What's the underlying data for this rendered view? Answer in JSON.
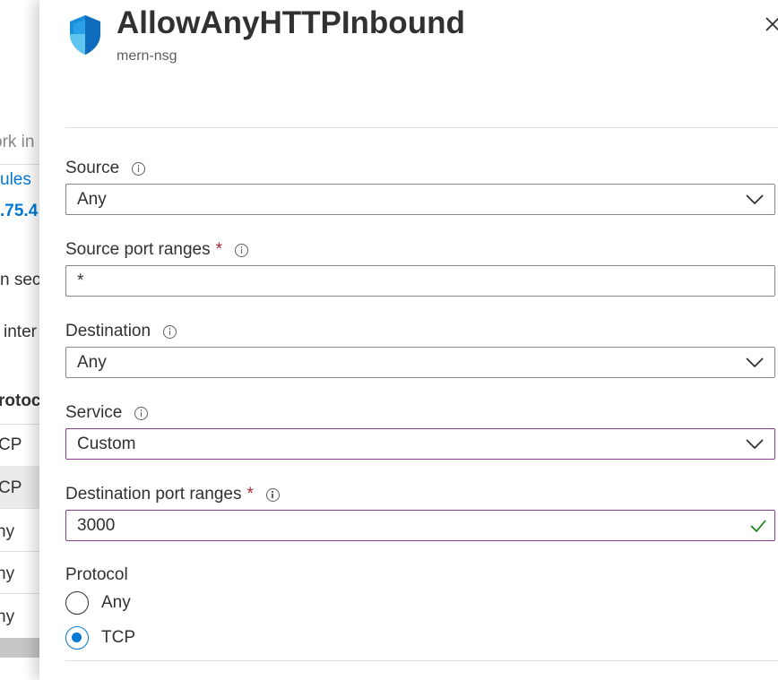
{
  "background": {
    "fragments": [
      "ork in",
      "ules",
      ".75.4",
      "n sec",
      "inter",
      "rotoc",
      "CP",
      "CP",
      "ny",
      "ny",
      "ny"
    ]
  },
  "panel": {
    "title": "AllowAnyHTTPInbound",
    "subtitle": "mern-nsg",
    "close_icon": "close-icon"
  },
  "form": {
    "source": {
      "label": "Source",
      "value": "Any"
    },
    "source_port_ranges": {
      "label": "Source port ranges",
      "required": "*",
      "value": "*"
    },
    "destination": {
      "label": "Destination",
      "value": "Any"
    },
    "service": {
      "label": "Service",
      "value": "Custom"
    },
    "destination_port_ranges": {
      "label": "Destination port ranges",
      "required": "*",
      "value": "3000"
    },
    "protocol": {
      "label": "Protocol",
      "options": [
        "Any",
        "TCP"
      ],
      "selected": "TCP"
    }
  },
  "colors": {
    "accent": "#0078d4",
    "required": "#a4262c",
    "focus_border": "#8e3c92",
    "valid_check": "#107c10"
  }
}
